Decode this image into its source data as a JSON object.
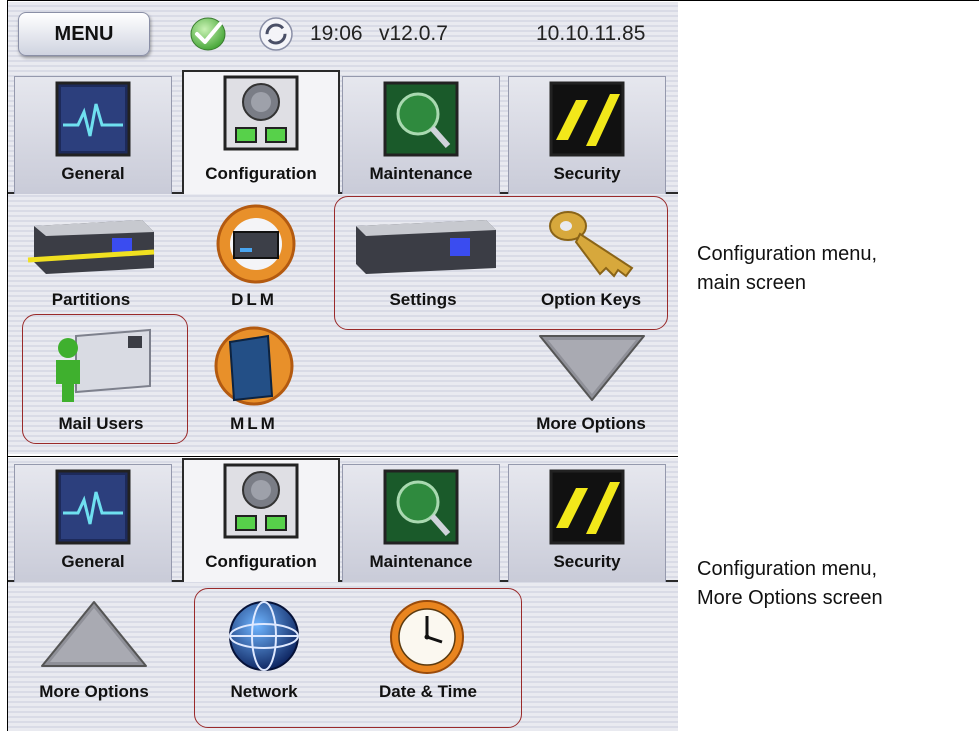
{
  "header": {
    "menu_label": "MENU",
    "status_icon": "check-icon",
    "sync_icon": "sync-icon",
    "time": "19:06",
    "version": "v12.0.7",
    "ip": "10.10.11.85"
  },
  "tabs": [
    {
      "label": "General",
      "icon": "heartbeat-monitor-icon",
      "active": false
    },
    {
      "label": "Configuration",
      "icon": "dial-icon",
      "active": true
    },
    {
      "label": "Maintenance",
      "icon": "magnifier-icon",
      "active": false
    },
    {
      "label": "Security",
      "icon": "hazard-stripe-icon",
      "active": false
    }
  ],
  "main_screen": {
    "items": [
      {
        "label": "Partitions",
        "icon": "library-icon"
      },
      {
        "label": "DLM",
        "icon": "dlm-drive-icon"
      },
      {
        "label": "Settings",
        "icon": "library-settings-icon"
      },
      {
        "label": "Option Keys",
        "icon": "key-icon"
      },
      {
        "label": "Mail Users",
        "icon": "mail-user-icon"
      },
      {
        "label": "MLM",
        "icon": "mlm-cartridge-icon"
      },
      {
        "label": "More Options",
        "icon": "triangle-down-icon"
      }
    ],
    "caption": [
      "Configuration menu,",
      "main screen"
    ]
  },
  "more_screen": {
    "items": [
      {
        "label": "More Options",
        "icon": "triangle-up-icon"
      },
      {
        "label": "Network",
        "icon": "globe-icon"
      },
      {
        "label": "Date & Time",
        "icon": "clock-icon"
      }
    ],
    "caption": [
      "Configuration menu,",
      "More Options screen"
    ]
  },
  "colors": {
    "highlight": "#9a2a2a",
    "status_green": "#5fc24a"
  }
}
